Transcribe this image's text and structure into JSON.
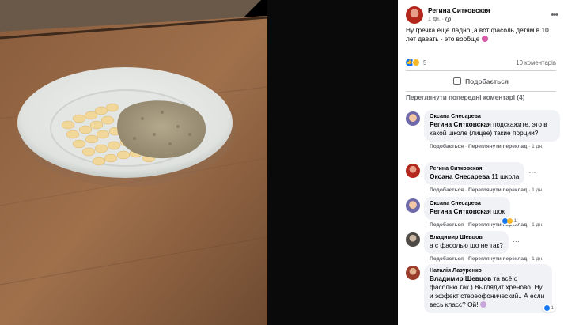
{
  "post": {
    "author": "Регина Ситковская",
    "time": "1 дн.",
    "text": "Ну гречка ещё ладно ,а вот фасоль детям в 10 лет давать - это вообще",
    "reactions_count": "5",
    "comments_count": "10 коментарів",
    "like_label": "Подобається",
    "prev_comments_label": "Переглянути попередні коментарі (4)"
  },
  "comments": [
    {
      "author": "Оксана Снесарева",
      "mention": "Регина Ситковская",
      "text": "подскажите, это в какой школе (лицее) такие порции?",
      "like": "Подобається",
      "translate": "Переглянути переклад",
      "time": "1 дн."
    },
    {
      "author": "Регина Ситковская",
      "mention": "Оксана Снесарева",
      "text": "11 школа",
      "like": "Подобається",
      "translate": "Переглянути переклад",
      "time": "1 дн."
    },
    {
      "author": "Оксана Снесарева",
      "mention": "Регина Ситковская",
      "text": "шок",
      "reactions": "1",
      "like": "Подобається",
      "translate": "Переглянути переклад",
      "time": "1 дн."
    },
    {
      "author": "Владимир Шевцов",
      "mention": "",
      "text": "а с фасолью шо не так?",
      "like": "Подобається",
      "translate": "Переглянути переклад",
      "time": "1 дн."
    },
    {
      "author": "Наталія Лазуренко",
      "mention": "Владимир Шевцов",
      "text": "та всё с фасолью так.) Выглядит хреново. Ну и эффект стереофонический.. А если весь класс? Ой!",
      "reactions": "1"
    }
  ],
  "colors": {
    "accent": "#1877f2",
    "secondary_text": "#65676b",
    "bubble": "#f0f2f5"
  }
}
